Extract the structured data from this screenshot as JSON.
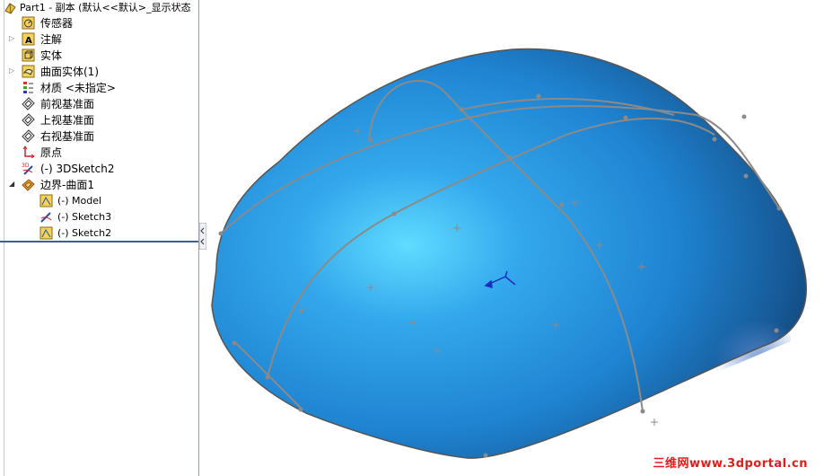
{
  "tree": {
    "title": "Part1 - 副本 (默认<<默认>_显示状态",
    "items": [
      {
        "label": "传感器",
        "icon": "sensor-icon"
      },
      {
        "label": "注解",
        "icon": "annotation-icon"
      },
      {
        "label": "实体",
        "icon": "solid-body-icon"
      },
      {
        "label": "曲面实体(1)",
        "icon": "surface-body-icon"
      },
      {
        "label": "材质 <未指定>",
        "icon": "material-icon"
      },
      {
        "label": "前视基准面",
        "icon": "plane-icon"
      },
      {
        "label": "上视基准面",
        "icon": "plane-icon"
      },
      {
        "label": "右视基准面",
        "icon": "plane-icon"
      },
      {
        "label": "原点",
        "icon": "origin-icon"
      },
      {
        "label": "(-) 3DSketch2",
        "icon": "3d-sketch-icon"
      },
      {
        "label": "边界-曲面1",
        "icon": "boundary-surface-icon"
      }
    ],
    "children": [
      {
        "label": "(-) Model",
        "icon": "sketch-icon"
      },
      {
        "label": "(-) Sketch3",
        "icon": "sketch-curve-icon"
      },
      {
        "label": "(-) Sketch2",
        "icon": "sketch-icon"
      }
    ]
  },
  "viewport": {
    "surface_color": "#2f97e0",
    "edge_color": "#8a8a8a"
  },
  "watermark": "三维网www.3dportal.cn"
}
